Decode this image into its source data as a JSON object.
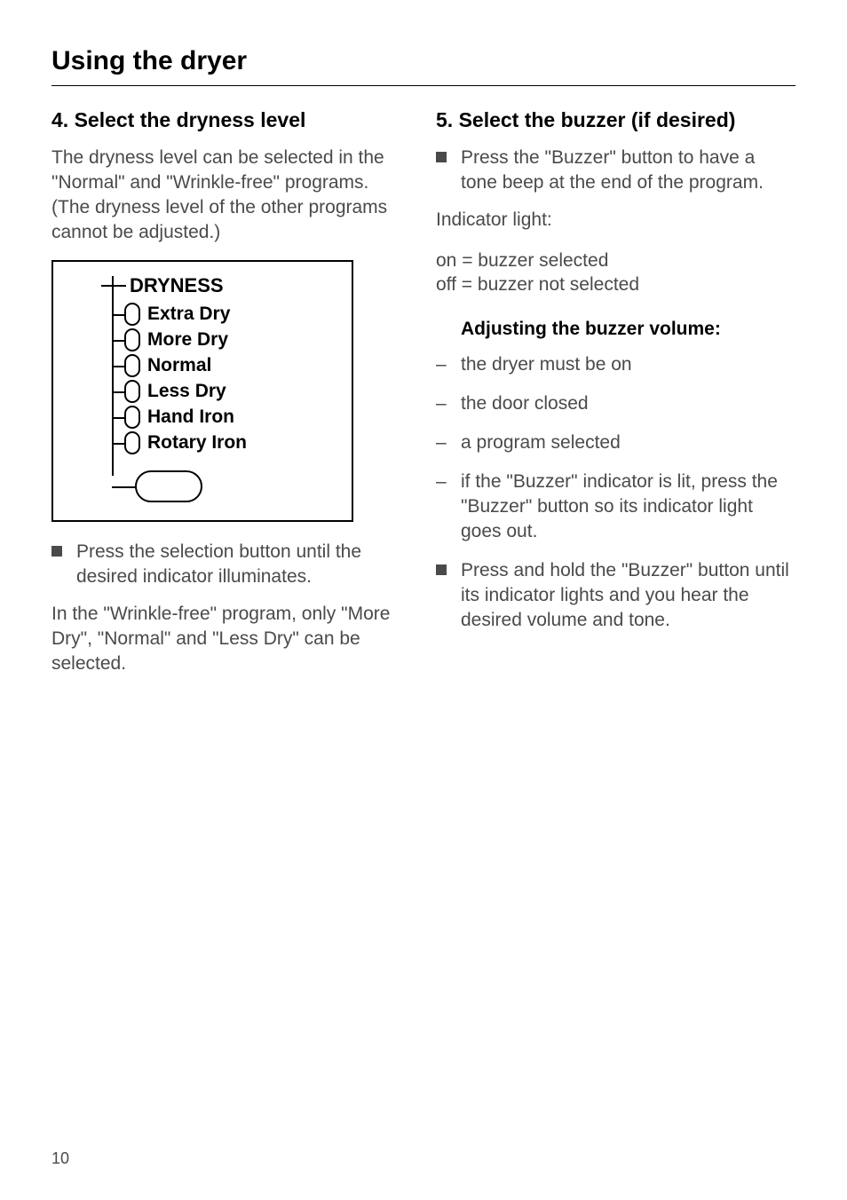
{
  "page": {
    "title": "Using the dryer",
    "number": "10"
  },
  "left": {
    "heading": "4. Select the dryness level",
    "intro": "The dryness level can be selected in the \"Normal\" and \"Wrinkle-free\" programs. (The dryness level of the other programs cannot be adjusted.)",
    "figure": {
      "label": "DRYNESS",
      "options": {
        "0": "Extra Dry",
        "1": "More Dry",
        "2": "Normal",
        "3": "Less Dry",
        "4": "Hand Iron",
        "5": "Rotary Iron"
      }
    },
    "bullet1": "Press the selection button until the desired indicator illuminates.",
    "note": "In the \"Wrinkle-free\" program, only \"More Dry\", \"Normal\" and \"Less Dry\" can be selected."
  },
  "right": {
    "heading": "5. Select the buzzer (if desired)",
    "bullet1": "Press the \"Buzzer\" button to have a tone beep at the end of the program.",
    "indicator_label": "Indicator light:",
    "indicator_on": "on = buzzer selected",
    "indicator_off": "off = buzzer not selected",
    "sub_heading": "Adjusting the buzzer volume:",
    "dash": {
      "0": "the dryer must be on",
      "1": "the door closed",
      "2": "a program selected",
      "3": "if the \"Buzzer\" indicator is lit, press the \"Buzzer\" button so its indicator light goes out."
    },
    "bullet2": "Press and hold the \"Buzzer\" button until its indicator lights and you hear the desired volume and tone."
  }
}
